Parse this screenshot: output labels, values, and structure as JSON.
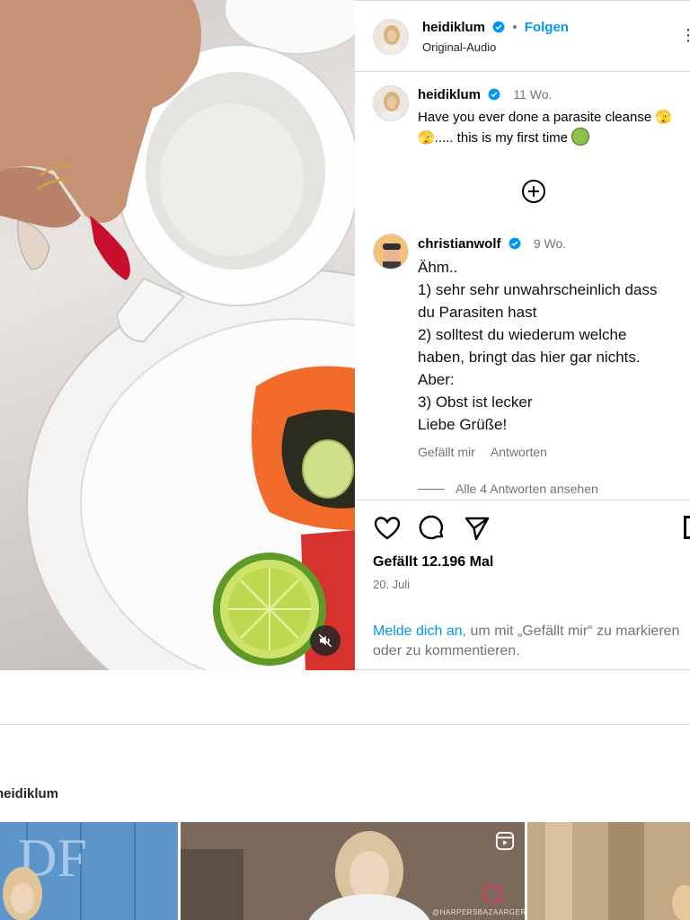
{
  "post": {
    "author": "heidiklum",
    "follow_label": "Folgen",
    "dot": "•",
    "audio": "Original-Audio",
    "more": "⋮",
    "mute_icon": "muted-speaker-icon"
  },
  "caption": {
    "author": "heidiklum",
    "time": "11 Wo.",
    "text": "Have you ever done a parasite cleanse 🫣🫣..... this is my first time"
  },
  "comment": {
    "author": "christianwolf",
    "time": "9 Wo.",
    "lines": [
      "Ähm..",
      "1) sehr sehr unwahrscheinlich dass",
      "du Parasiten hast",
      "2) solltest du wiederum welche",
      "haben, bringt das hier gar nichts.",
      "Aber:",
      "3) Obst ist lecker",
      "Liebe Grüße!"
    ],
    "like_label": "Gefällt mir",
    "reply_label": "Antworten",
    "view_replies": "Alle 4 Antworten ansehen"
  },
  "stats": {
    "likes": "Gefällt 12.196 Mal",
    "date": "20. Juli"
  },
  "login": {
    "link": "Melde dich an",
    "rest": ", um mit „Gefällt mir“ zu markieren oder zu kommentieren."
  },
  "more_posts": {
    "title": "heidiklum",
    "watermark": "@HARPERSBAZAARGERMANY"
  },
  "colors": {
    "link_blue": "#0095f6",
    "muted_gray": "#737373",
    "border": "#dbdbdb"
  }
}
